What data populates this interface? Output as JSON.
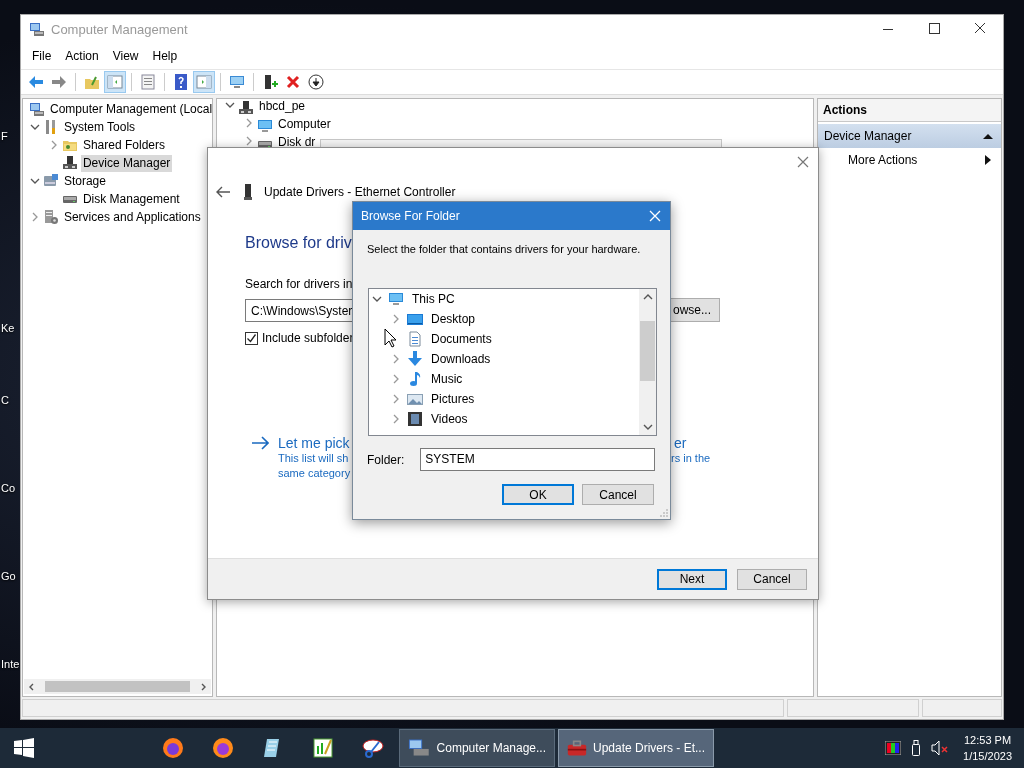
{
  "desktop": {
    "icon_labels": [
      "F",
      "Ke",
      "C",
      "Co",
      "Go",
      "Inte"
    ]
  },
  "main_window": {
    "title": "Computer Management",
    "menu": [
      "File",
      "Action",
      "View",
      "Help"
    ],
    "toolbar": [
      {
        "pressed": false
      },
      {
        "pressed": false
      },
      {
        "pressed": false
      },
      {
        "pressed": true
      },
      {
        "pressed": false
      },
      {
        "pressed": false
      },
      {
        "pressed": true
      },
      {
        "pressed": false
      },
      {
        "pressed": false
      },
      {
        "pressed": false
      },
      {
        "pressed": false
      }
    ],
    "tree": [
      {
        "label": "Computer Management (Local",
        "selected": false,
        "children": [
          {
            "label": "System Tools",
            "selected": false,
            "expanded": true,
            "children": [
              {
                "label": "Shared Folders",
                "selected": false,
                "expanded": false
              },
              {
                "label": "Device Manager",
                "selected": true
              }
            ]
          },
          {
            "label": "Storage",
            "selected": false,
            "expanded": true,
            "children": [
              {
                "label": "Disk Management",
                "selected": false
              }
            ]
          },
          {
            "label": "Services and Applications",
            "selected": false,
            "expanded": false
          }
        ]
      }
    ],
    "device_tree": [
      {
        "label": "hbcd_pe",
        "selected": false,
        "expanded": true,
        "children": [
          {
            "label": "Computer",
            "selected": false,
            "expanded": false
          },
          {
            "label": "Disk dr",
            "selected": false,
            "expanded": false
          }
        ]
      }
    ],
    "actions": {
      "header": "Actions",
      "section": {
        "label": "Device Manager",
        "expanded": true
      },
      "items": [
        {
          "label": "More Actions"
        }
      ]
    }
  },
  "update_dialog": {
    "title": "Update Drivers - Ethernet Controller",
    "heading": "Browse for driv",
    "search_label": "Search for drivers in",
    "path_value": "C:\\Windows\\Syster",
    "browse_button": "owse...",
    "include_subfolders": {
      "label": "Include subfolder",
      "checked": true
    },
    "link": {
      "left": "Let me pick",
      "right": "er"
    },
    "description": {
      "left_lines": [
        "This list will sh",
        "same category"
      ],
      "right_lines": [
        "rs in the"
      ]
    },
    "buttons": [
      {
        "label": "Next",
        "default": true
      },
      {
        "label": "Cancel",
        "default": false
      }
    ]
  },
  "browse_dialog": {
    "title": "Browse For Folder",
    "prompt": "Select the folder that contains drivers for your hardware.",
    "tree": [
      {
        "label": "This PC",
        "selected": false,
        "expanded": true,
        "children": [
          {
            "label": "Desktop",
            "selected": false,
            "expanded": false
          },
          {
            "label": "Documents",
            "selected": false
          },
          {
            "label": "Downloads",
            "selected": false,
            "expanded": false
          },
          {
            "label": "Music",
            "selected": false,
            "expanded": false
          },
          {
            "label": "Pictures",
            "selected": false,
            "expanded": false
          },
          {
            "label": "Videos",
            "selected": false,
            "expanded": false
          }
        ]
      }
    ],
    "folder_label": "Folder:",
    "folder_value": "SYSTEM",
    "buttons": [
      {
        "label": "OK",
        "default": true
      },
      {
        "label": "Cancel",
        "default": false
      }
    ]
  },
  "taskbar": {
    "tasks": [
      {
        "label": "Computer Manage...",
        "selected": false
      },
      {
        "label": "Update Drivers - Et...",
        "selected": true
      }
    ],
    "clock": {
      "time": "12:53 PM",
      "date": "1/15/2023"
    }
  }
}
